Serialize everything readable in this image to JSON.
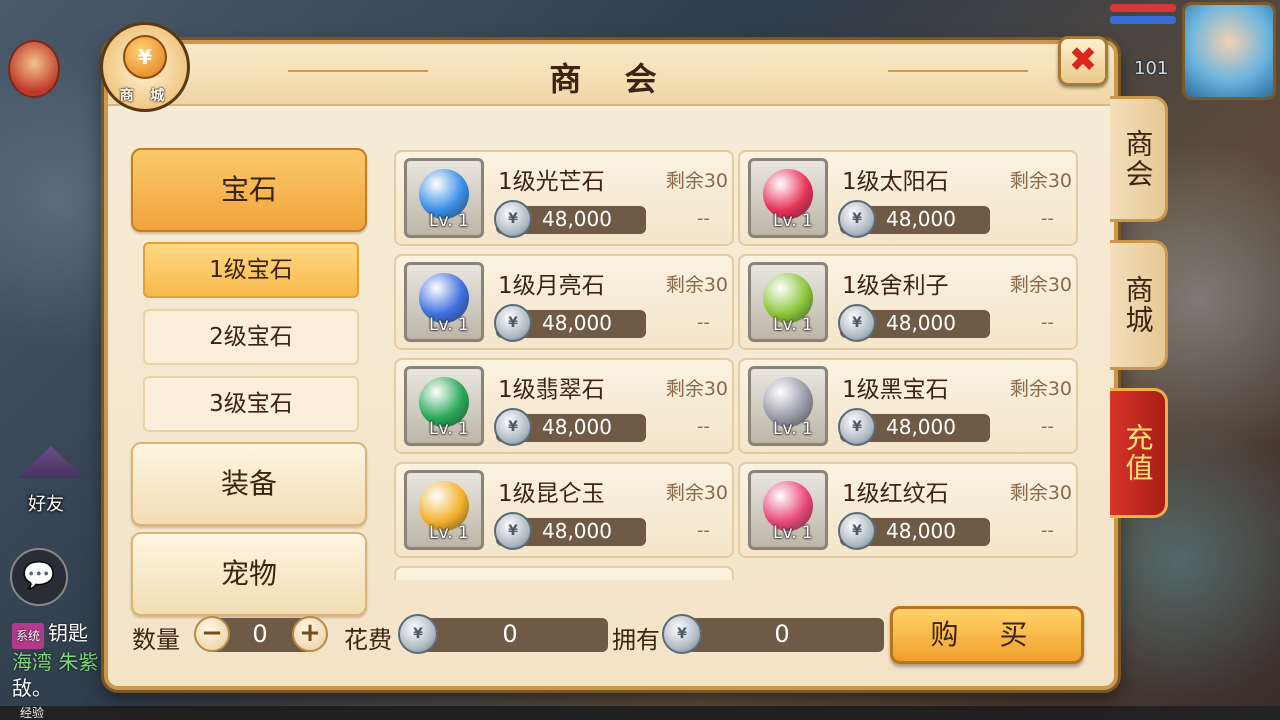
{
  "window": {
    "title": "商 会",
    "mall_badge_label": "商 城",
    "mall_badge_symbol": "¥",
    "close_symbol": "✖"
  },
  "side_tabs": [
    "商会",
    "商城",
    "充值"
  ],
  "categories": {
    "gem": "宝石",
    "gem_levels": [
      "1级宝石",
      "2级宝石",
      "3级宝石"
    ],
    "equipment": "装备",
    "pet": "宠物"
  },
  "items": [
    {
      "name": "1级光芒石",
      "remain": "剩余30",
      "price": "48,000",
      "level": "Lv. 1",
      "dash": "--",
      "color": "#3a8ee6"
    },
    {
      "name": "1级太阳石",
      "remain": "剩余30",
      "price": "48,000",
      "level": "Lv. 1",
      "dash": "--",
      "color": "#e8325a"
    },
    {
      "name": "1级月亮石",
      "remain": "剩余30",
      "price": "48,000",
      "level": "Lv. 1",
      "dash": "--",
      "color": "#3f6fe0"
    },
    {
      "name": "1级舍利子",
      "remain": "剩余30",
      "price": "48,000",
      "level": "Lv. 1",
      "dash": "--",
      "color": "#8cc63a"
    },
    {
      "name": "1级翡翠石",
      "remain": "剩余30",
      "price": "48,000",
      "level": "Lv. 1",
      "dash": "--",
      "color": "#2aa85a"
    },
    {
      "name": "1级黑宝石",
      "remain": "剩余30",
      "price": "48,000",
      "level": "Lv. 1",
      "dash": "--",
      "color": "#9a9aa8"
    },
    {
      "name": "1级昆仑玉",
      "remain": "剩余30",
      "price": "48,000",
      "level": "Lv. 1",
      "dash": "--",
      "color": "#f2b02a"
    },
    {
      "name": "1级红纹石",
      "remain": "剩余30",
      "price": "48,000",
      "level": "Lv. 1",
      "dash": "--",
      "color": "#e8487a"
    }
  ],
  "bottom": {
    "qty_label": "数量",
    "qty_value": "0",
    "minus": "−",
    "plus": "+",
    "cost_label": "花费",
    "cost_value": "0",
    "own_label": "拥有",
    "own_value": "0",
    "buy_label": "购 买"
  },
  "hud": {
    "friend_label": "好友",
    "chat_icon": "💬",
    "log_tag": "系统",
    "log_lines": [
      "钥匙",
      "海湾 朱紫",
      "敌。"
    ],
    "level_value": "101",
    "exp_label": "经验"
  }
}
